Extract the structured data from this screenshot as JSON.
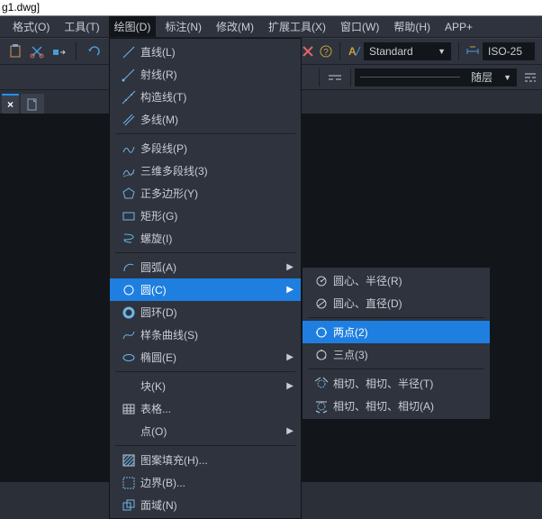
{
  "title": "g1.dwg]",
  "menubar": [
    "格式(O)",
    "工具(T)",
    "绘图(D)",
    "标注(N)",
    "修改(M)",
    "扩展工具(X)",
    "窗口(W)",
    "帮助(H)",
    "APP+"
  ],
  "menubar_open_index": 2,
  "toolbar1": {
    "standard_label": "Standard",
    "dimstyle_label": "ISO-25"
  },
  "toolbar2": {
    "layer_label": "随层"
  },
  "document_tab_close": "×",
  "draw_menu": [
    {
      "icon": "line",
      "label": "直线(L)"
    },
    {
      "icon": "ray",
      "label": "射线(R)"
    },
    {
      "icon": "xline",
      "label": "构造线(T)"
    },
    {
      "icon": "mline",
      "label": "多线(M)"
    },
    {
      "sep": true
    },
    {
      "icon": "pline",
      "label": "多段线(P)"
    },
    {
      "icon": "pline3d",
      "label": "三维多段线(3)"
    },
    {
      "icon": "polygon",
      "label": "正多边形(Y)"
    },
    {
      "icon": "rect",
      "label": "矩形(G)"
    },
    {
      "icon": "helix",
      "label": "螺旋(I)"
    },
    {
      "sep": true
    },
    {
      "icon": "arc",
      "label": "圆弧(A)",
      "sub": true
    },
    {
      "icon": "circle",
      "label": "圆(C)",
      "sub": true,
      "hover": true
    },
    {
      "icon": "donut",
      "label": "圆环(D)"
    },
    {
      "icon": "spline",
      "label": "样条曲线(S)"
    },
    {
      "icon": "ellipse",
      "label": "椭圆(E)",
      "sub": true
    },
    {
      "sep": true
    },
    {
      "icon": "block",
      "label": "块(K)",
      "sub": true
    },
    {
      "icon": "table",
      "label": "表格..."
    },
    {
      "icon": "point",
      "label": "点(O)",
      "sub": true
    },
    {
      "sep": true
    },
    {
      "icon": "hatch",
      "label": "图案填充(H)..."
    },
    {
      "icon": "boundary",
      "label": "边界(B)..."
    },
    {
      "icon": "region",
      "label": "面域(N)"
    }
  ],
  "circle_submenu": [
    {
      "icon": "c-cr",
      "label": "圆心、半径(R)"
    },
    {
      "icon": "c-cd",
      "label": "圆心、直径(D)"
    },
    {
      "sep": true
    },
    {
      "icon": "c-2p",
      "label": "两点(2)",
      "hover": true
    },
    {
      "icon": "c-3p",
      "label": "三点(3)"
    },
    {
      "sep": true
    },
    {
      "icon": "c-ttr",
      "label": "相切、相切、半径(T)"
    },
    {
      "icon": "c-ttt",
      "label": "相切、相切、相切(A)"
    }
  ]
}
